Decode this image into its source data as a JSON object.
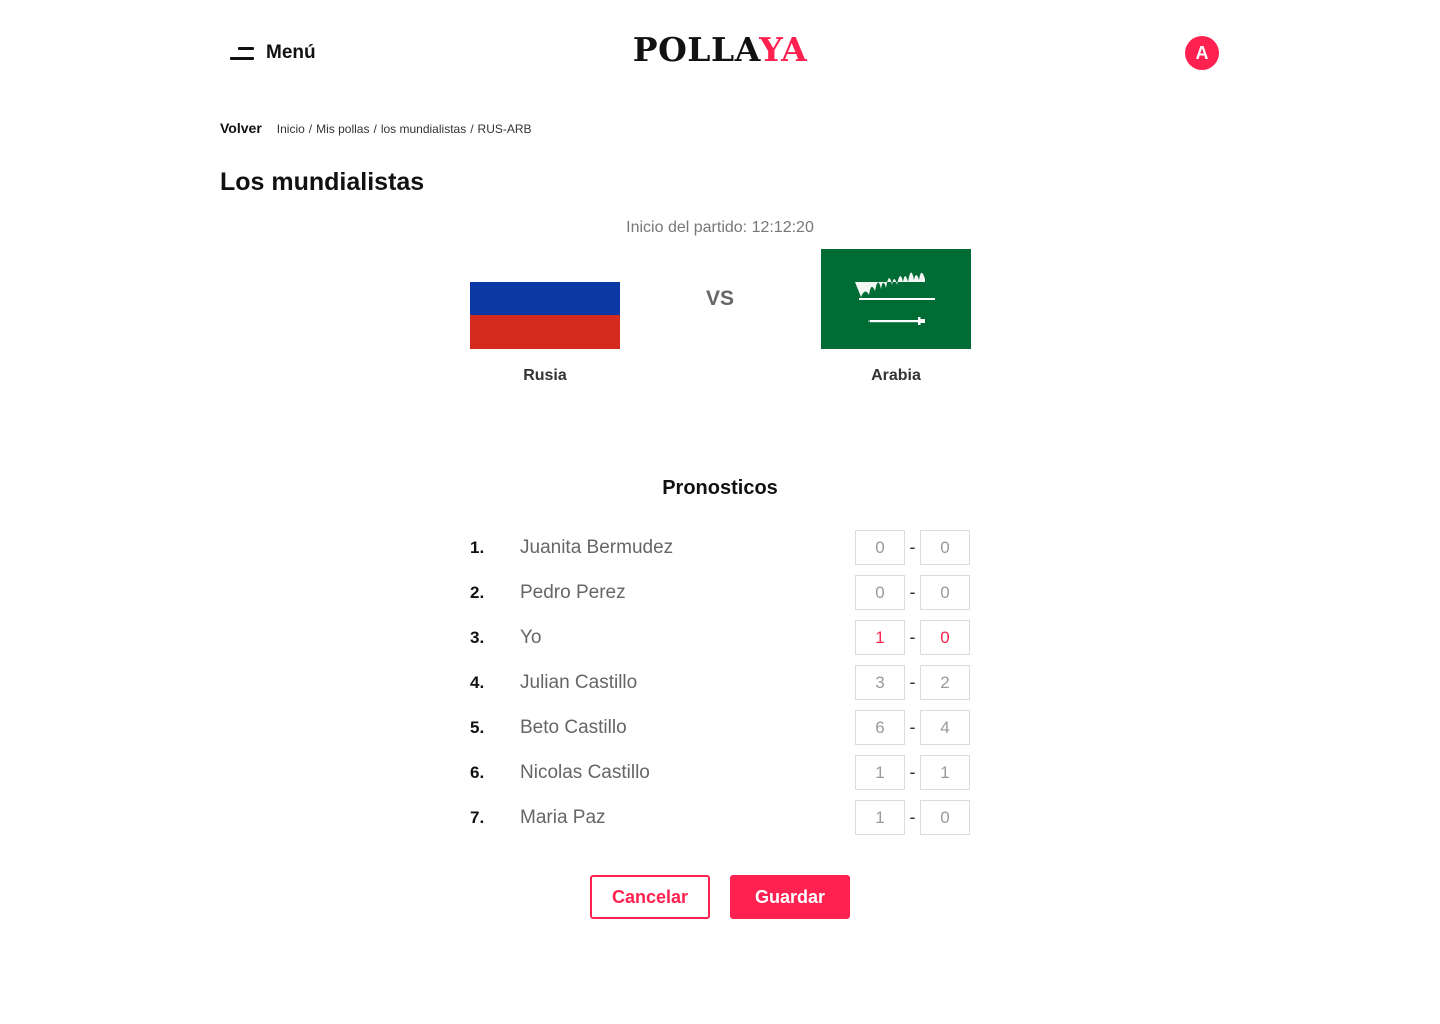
{
  "header": {
    "menu_label": "Menú",
    "logo_part1": "POLLA",
    "logo_part2": "YA",
    "avatar_initial": "A"
  },
  "breadcrumb": {
    "back_label": "Volver",
    "items": [
      "Inicio",
      "Mis pollas",
      "los mundialistas",
      "RUS-ARB"
    ]
  },
  "page_title": "Los mundialistas",
  "match": {
    "kickoff": "Inicio del partido: 12:12:20",
    "vs": "VS",
    "home": {
      "name": "Rusia",
      "flag_icon": "russia-flag-icon"
    },
    "away": {
      "name": "Arabia",
      "flag_icon": "saudi-arabia-flag-icon"
    }
  },
  "predictions": {
    "title": "Pronosticos",
    "rows": [
      {
        "rank": "1.",
        "name": "Juanita Bermudez",
        "home": "0",
        "away": "0"
      },
      {
        "rank": "2.",
        "name": "Pedro Perez",
        "home": "0",
        "away": "0"
      },
      {
        "rank": "3.",
        "name": "Yo",
        "home": "1",
        "away": "0"
      },
      {
        "rank": "4.",
        "name": "Julian Castillo",
        "home": "3",
        "away": "2"
      },
      {
        "rank": "5.",
        "name": "Beto Castillo",
        "home": "6",
        "away": "4"
      },
      {
        "rank": "6.",
        "name": "Nicolas Castillo",
        "home": "1",
        "away": "1"
      },
      {
        "rank": "7.",
        "name": "Maria Paz",
        "home": "1",
        "away": "0"
      }
    ],
    "separator": "-"
  },
  "actions": {
    "cancel_label": "Cancelar",
    "save_label": "Guardar"
  },
  "colors": {
    "accent": "#ff2150",
    "russia_blue": "#0a39a5",
    "russia_red": "#d52b1e",
    "saudi_green": "#006c35"
  }
}
